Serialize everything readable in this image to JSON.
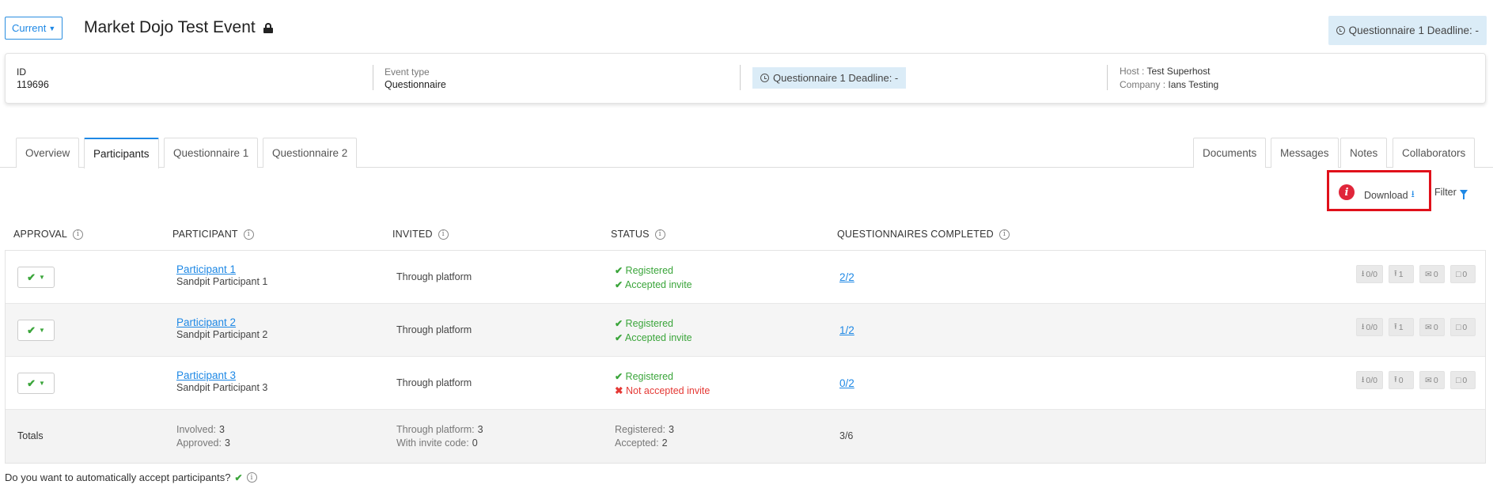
{
  "header": {
    "current_label": "Current",
    "event_title": "Market Dojo Test Event",
    "deadline_badge": "Questionnaire 1 Deadline: -"
  },
  "info": {
    "id_label": "ID",
    "id_value": "119696",
    "event_type_label": "Event type",
    "event_type_value": "Questionnaire",
    "deadline": "Questionnaire 1 Deadline: -",
    "host_label": "Host :",
    "host_value": "Test Superhost",
    "company_label": "Company :",
    "company_value": "Ians Testing"
  },
  "tabs_left": [
    "Overview",
    "Participants",
    "Questionnaire 1",
    "Questionnaire 2"
  ],
  "tabs_right": [
    "Documents",
    "Messages",
    "Notes",
    "Collaborators"
  ],
  "active_tab": "Participants",
  "toolbar": {
    "download_label": "Download",
    "filter_label": "Filter"
  },
  "columns": {
    "approval": "APPROVAL",
    "participant": "PARTICIPANT",
    "invited": "INVITED",
    "status": "STATUS",
    "questionnaires": "QUESTIONNAIRES COMPLETED"
  },
  "rows": [
    {
      "name": "Participant 1",
      "company": "Sandpit Participant 1",
      "invited": "Through platform",
      "status1": "Registered",
      "status2": "Accepted invite",
      "status2_ok": true,
      "completed": "2/2",
      "downloads": "0/0",
      "uploads": "1",
      "messages": "0",
      "notes": "0"
    },
    {
      "name": "Participant 2",
      "company": "Sandpit Participant 2",
      "invited": "Through platform",
      "status1": "Registered",
      "status2": "Accepted invite",
      "status2_ok": true,
      "completed": "1/2",
      "downloads": "0/0",
      "uploads": "1",
      "messages": "0",
      "notes": "0"
    },
    {
      "name": "Participant 3",
      "company": "Sandpit Participant 3",
      "invited": "Through platform",
      "status1": "Registered",
      "status2": "Not accepted invite",
      "status2_ok": false,
      "completed": "0/2",
      "downloads": "0/0",
      "uploads": "0",
      "messages": "0",
      "notes": "0"
    }
  ],
  "totals": {
    "label": "Totals",
    "involved_label": "Involved:",
    "involved": "3",
    "approved_label": "Approved:",
    "approved": "3",
    "through_platform_label": "Through platform:",
    "through_platform": "3",
    "invite_code_label": "With invite code:",
    "invite_code": "0",
    "registered_label": "Registered:",
    "registered": "3",
    "accepted_label": "Accepted:",
    "accepted": "2",
    "completed": "3/6"
  },
  "auto_accept_text": "Do you want to automatically accept participants?",
  "colors": {
    "accent": "#1e88e5",
    "success": "#3aa53a",
    "danger": "#e53935",
    "highlight": "#e0101a"
  }
}
